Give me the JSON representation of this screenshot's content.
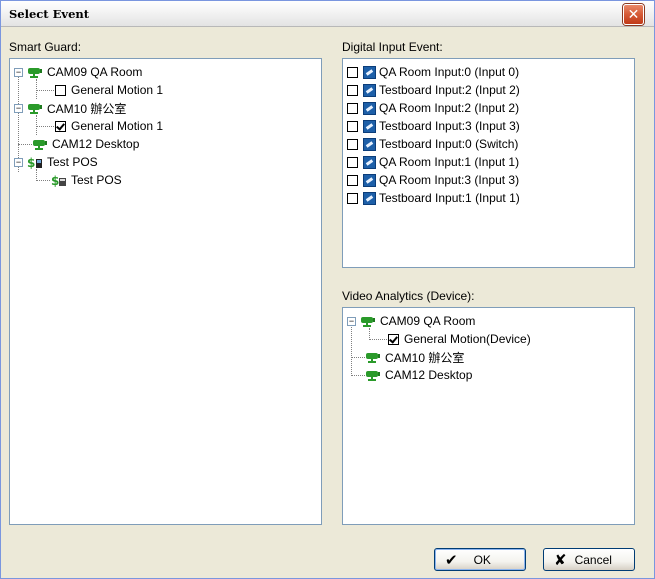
{
  "window": {
    "title": "Select Event",
    "close_glyph": "✕"
  },
  "smart_guard": {
    "label": "Smart Guard:",
    "tree": [
      {
        "label": "CAM09 QA Room",
        "type": "camera",
        "expanded": true
      },
      {
        "label": "General Motion 1",
        "type": "checkbox",
        "checked": false
      },
      {
        "label": "CAM10 辦公室",
        "type": "camera",
        "expanded": true
      },
      {
        "label": "General Motion 1",
        "type": "checkbox",
        "checked": true
      },
      {
        "label": "CAM12 Desktop",
        "type": "camera"
      },
      {
        "label": "Test POS",
        "type": "pos",
        "expanded": true
      },
      {
        "label": "Test POS",
        "type": "pos-child"
      }
    ]
  },
  "digital_input": {
    "label": "Digital Input Event:",
    "items": [
      "QA Room Input:0 (Input 0)",
      "Testboard Input:2 (Input 2)",
      "QA Room Input:2 (Input 2)",
      "Testboard Input:3 (Input 3)",
      "Testboard Input:0 (Switch)",
      "QA Room Input:1 (Input 1)",
      "QA Room Input:3 (Input 3)",
      "Testboard Input:1 (Input 1)"
    ]
  },
  "video_analytics": {
    "label": "Video Analytics (Device):",
    "tree": [
      {
        "label": "CAM09 QA Room",
        "type": "camera",
        "expanded": true
      },
      {
        "label": "General Motion(Device)",
        "type": "checkbox",
        "checked": true
      },
      {
        "label": "CAM10 辦公室",
        "type": "camera"
      },
      {
        "label": "CAM12 Desktop",
        "type": "camera"
      }
    ]
  },
  "buttons": {
    "ok": "OK",
    "ok_glyph": "✔",
    "cancel": "Cancel",
    "cancel_glyph": "✘"
  },
  "colors": {
    "camera_green": "#2a9a2a",
    "accent_blue": "#1d5fa8",
    "close_red": "#d55a36"
  }
}
